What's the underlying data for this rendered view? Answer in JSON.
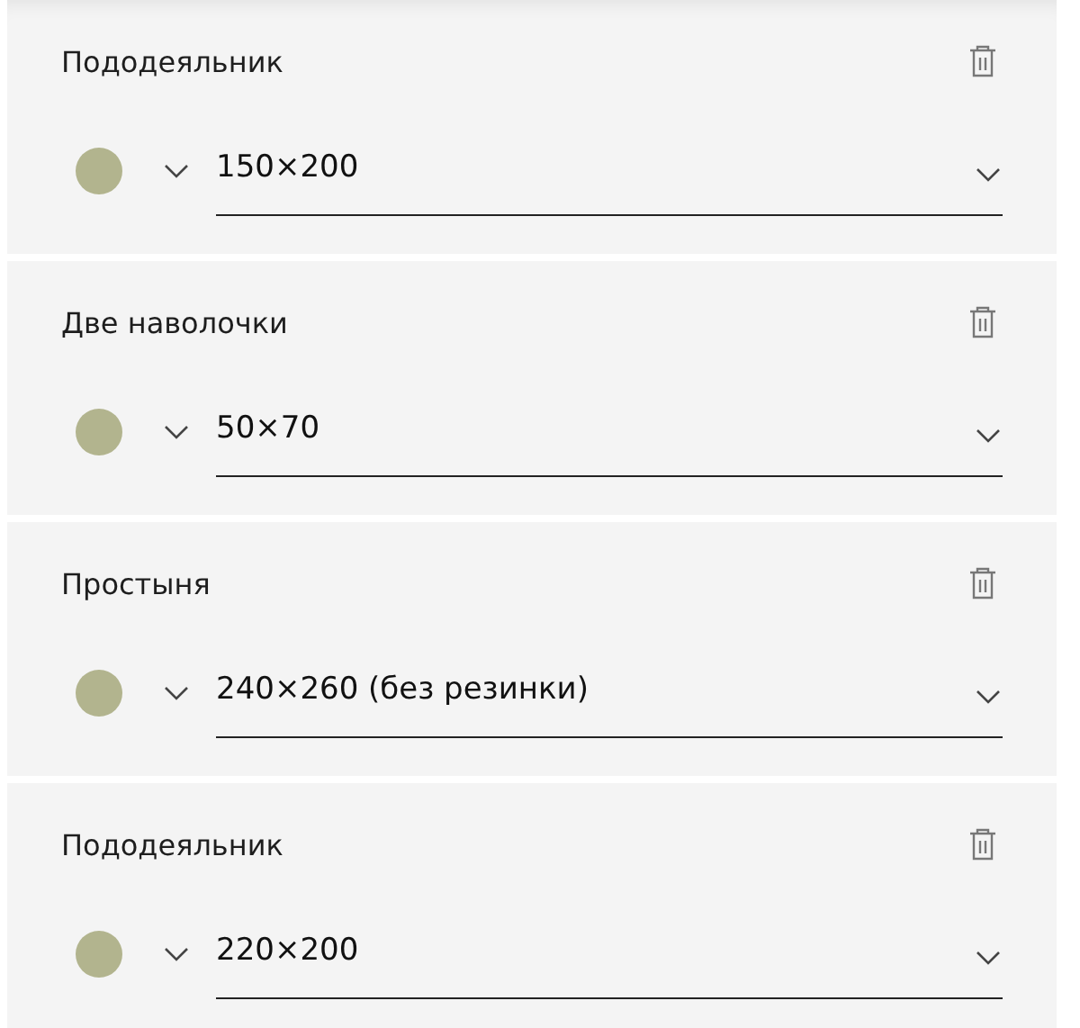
{
  "items": [
    {
      "name": "Пододеяльник",
      "color": "#b2b48e",
      "size": "150×200"
    },
    {
      "name": "Две наволочки",
      "color": "#b2b48e",
      "size": "50×70"
    },
    {
      "name": "Простыня",
      "color": "#b2b48e",
      "size": "240×260 (без резинки)"
    },
    {
      "name": "Пододеяльник",
      "color": "#b2b48e",
      "size": "220×200"
    }
  ]
}
